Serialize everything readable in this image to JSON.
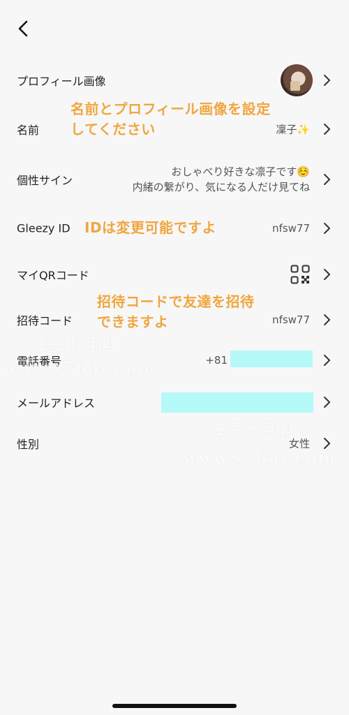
{
  "header": {
    "back_icon": "chevron-left-icon"
  },
  "rows": [
    {
      "label": "プロフィール画像",
      "value": ""
    },
    {
      "label": "名前",
      "value": "凜子✨"
    },
    {
      "label": "個性サイン",
      "value_line1": "おしゃべり好きな凛子です☺️",
      "value_line2": "内緒の繋がり、気になる人だけ見てね"
    },
    {
      "label": "Gleezy ID",
      "value": "nfsw77"
    },
    {
      "label": "マイQRコード",
      "value": ""
    },
    {
      "label": "招待コード",
      "value": "nfsw77"
    },
    {
      "label": "電話番号",
      "value": "+81"
    },
    {
      "label": "メールアドレス",
      "value": ""
    },
    {
      "label": "性別",
      "value": "女性"
    }
  ],
  "annotations": {
    "name_hint_line1": "名前とプロフィール画像を設定",
    "name_hint_line2": "してください",
    "id_hint": "IDは変更可能ですよ",
    "invite_hint_line1": "招待コードで友達を招待",
    "invite_hint_line2": "できますよ"
  },
  "watermarks": {
    "cn_1": "凜子水月閣",
    "url_1": "www.s76av.com",
    "cn_2": "凜子水月閣",
    "url_2": "www.s76av.com"
  },
  "colors": {
    "background": "#f7f7f7",
    "annotation": "#f0a63f",
    "redaction": "#b6f9f9"
  }
}
